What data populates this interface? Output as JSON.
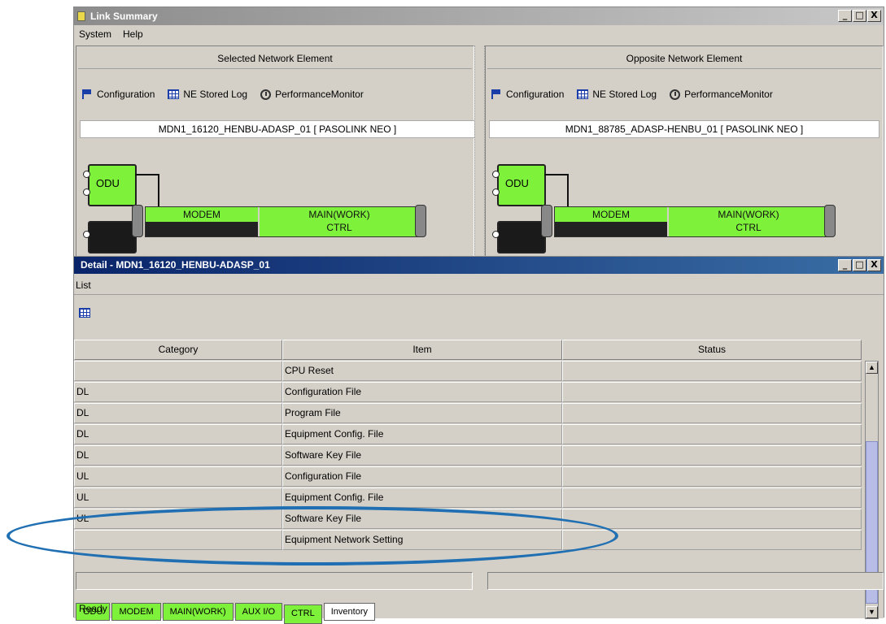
{
  "window": {
    "title": "Link Summary",
    "buttons": [
      "_",
      "□",
      "X"
    ]
  },
  "menu": {
    "system": "System",
    "help": "Help"
  },
  "left_panel": {
    "header": "Selected Network Element",
    "tools": {
      "configuration": "Configuration",
      "ne_stored_log": "NE Stored Log",
      "performance_monitor": "PerformanceMonitor"
    },
    "ne_name": "MDN1_16120_HENBU-ADASP_01 [ PASOLINK NEO ]",
    "diagram": {
      "odu": "ODU",
      "modem": "MODEM",
      "main": "MAIN(WORK)",
      "ctrl": "CTRL"
    }
  },
  "right_panel": {
    "header": "Opposite Network Element",
    "tools": {
      "configuration": "Configuration",
      "ne_stored_log": "NE Stored Log",
      "performance_monitor": "PerformanceMonitor"
    },
    "ne_name": "MDN1_88785_ADASP-HENBU_01 [ PASOLINK NEO ]",
    "diagram": {
      "odu": "ODU",
      "modem": "MODEM",
      "main": "MAIN(WORK)",
      "ctrl": "CTRL"
    }
  },
  "detail": {
    "title": "Detail - MDN1_16120_HENBU-ADASP_01",
    "menu_list": "List",
    "columns": [
      "Category",
      "Item",
      "Status"
    ],
    "rows": [
      {
        "category": "",
        "item": "CPU Reset",
        "status": ""
      },
      {
        "category": "DL",
        "item": "Configuration File",
        "status": ""
      },
      {
        "category": "DL",
        "item": "Program File",
        "status": ""
      },
      {
        "category": "DL",
        "item": "Equipment Config. File",
        "status": ""
      },
      {
        "category": "DL",
        "item": "Software Key File",
        "status": ""
      },
      {
        "category": "UL",
        "item": "Configuration File",
        "status": ""
      },
      {
        "category": "UL",
        "item": "Equipment Config. File",
        "status": ""
      },
      {
        "category": "UL",
        "item": "Software Key File",
        "status": ""
      },
      {
        "category": "",
        "item": "Equipment Network Setting",
        "status": ""
      }
    ],
    "tabs": [
      "ODU",
      "MODEM",
      "MAIN(WORK)",
      "AUX I/O",
      "CTRL",
      "Inventory"
    ],
    "status_text": "Ready"
  },
  "colors": {
    "green": "#7ef23a",
    "title_blue": "#0a246a",
    "highlight_oval": "#1f6fb2"
  }
}
